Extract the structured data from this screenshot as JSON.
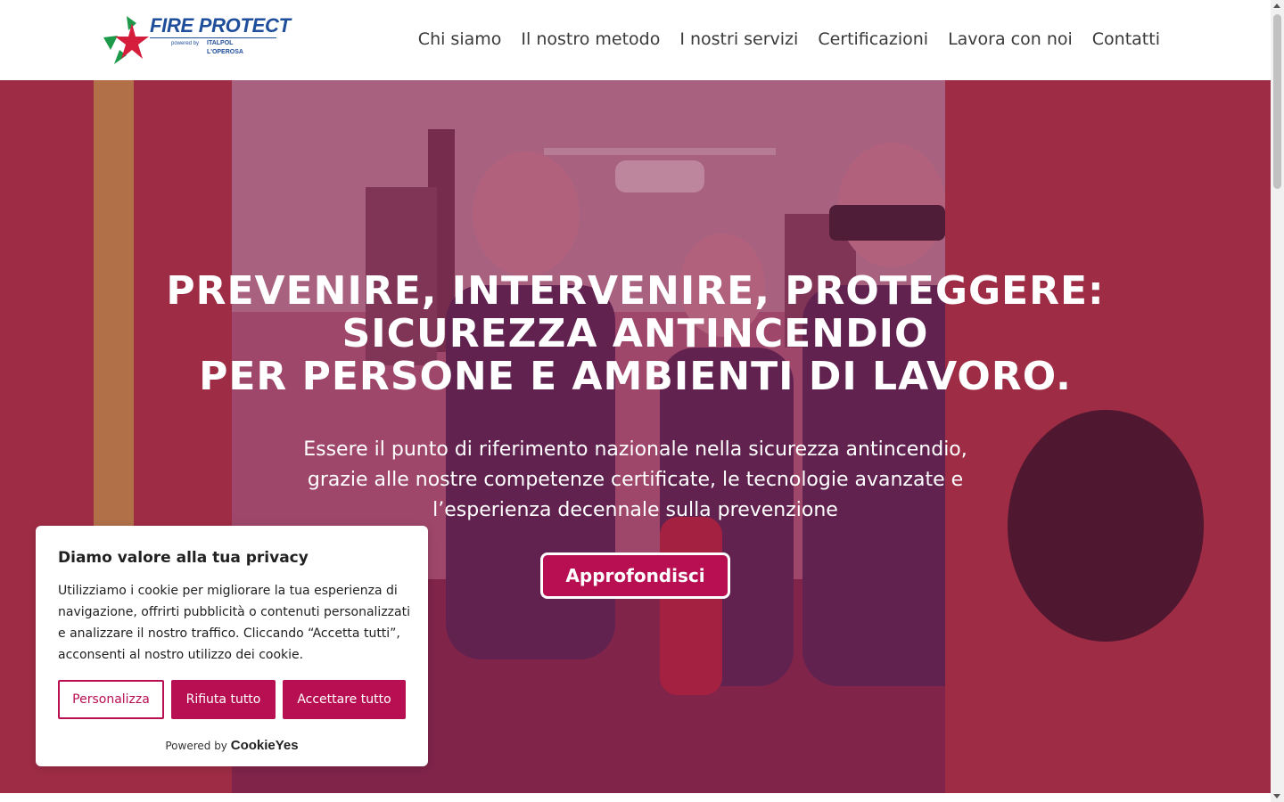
{
  "brand": {
    "name": "FIRE PROTECT",
    "powered_by": "powered by",
    "company_line1": "ITALPOL",
    "company_line2": "L'OPEROSA",
    "colors": {
      "blue": "#1f4e9a",
      "green": "#1c9a4a",
      "red": "#d51d3c"
    }
  },
  "nav": {
    "items": [
      "Chi siamo",
      "Il nostro metodo",
      "I nostri servizi",
      "Certificazioni",
      "Lavora con noi",
      "Contatti"
    ]
  },
  "hero": {
    "title_lines": [
      "PREVENIRE, INTERVENIRE, PROTEGGERE:",
      "SICUREZZA ANTINCENDIO",
      "PER PERSONE E AMBIENTI DI LAVORO."
    ],
    "subtitle_lines": [
      "Essere il punto di riferimento nazionale nella sicurezza antincendio,",
      "grazie alle nostre competenze certificate, le tecnologie avanzate e",
      "l’esperienza decennale sulla prevenzione"
    ],
    "cta_label": "Approfondisci",
    "accent_color": "#b80f52"
  },
  "cookie_banner": {
    "title": "Diamo valore alla tua privacy",
    "text": "Utilizziamo i cookie per migliorare la tua esperienza di navigazione, offrirti pubblicità o contenuti personalizzati e analizzare il nostro traffico. Cliccando “Accetta tutti”, acconsenti al nostro utilizzo dei cookie.",
    "buttons": {
      "customize": "Personalizza",
      "reject": "Rifiuta tutto",
      "accept": "Accettare tutto"
    },
    "powered_label": "Powered by",
    "powered_brand": "CookieYes"
  }
}
